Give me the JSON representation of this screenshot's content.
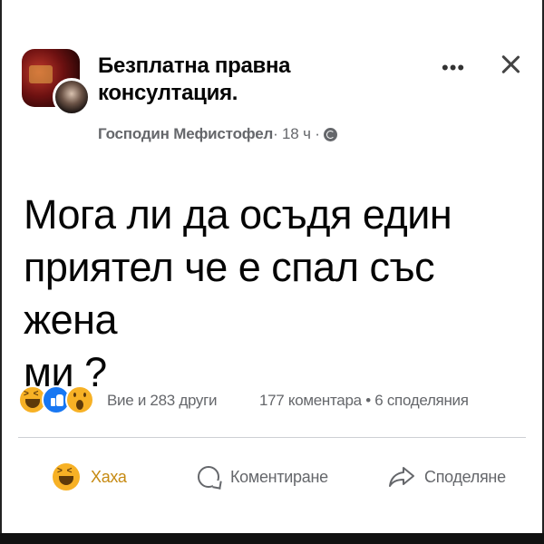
{
  "header": {
    "group_name": "Безплатна правна\nконсултация.",
    "author": "Господин Мефистофел",
    "time": " · 18 ч · ",
    "more_label": "•••",
    "icons": [
      "group-avatar",
      "user-avatar",
      "globe-icon",
      "more-icon",
      "close-icon"
    ]
  },
  "post": {
    "text": "Мога ли да осъдя един\nприятел че е спал със жена\nми ?"
  },
  "reactions": {
    "types": [
      "haha",
      "like",
      "wow"
    ],
    "summary": "Вие и 283 други",
    "comments_count": "177 коментара",
    "separator": " • ",
    "shares_count": "6 споделяния"
  },
  "actions": {
    "haha_label": "Хаха",
    "comment_label": "Коментиране",
    "share_label": "Споделяне"
  },
  "colors": {
    "secondary_text": "#65676b",
    "like_blue": "#1877f2",
    "haha_yellow": "#f7b125",
    "haha_label": "#c68a12"
  }
}
